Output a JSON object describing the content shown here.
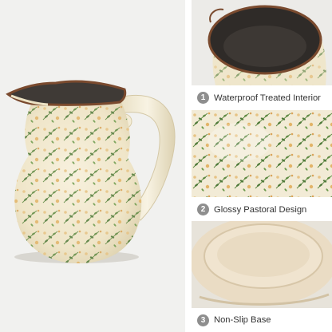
{
  "colors": {
    "background": "#f1f1ef",
    "glaze": "#f2ebd6",
    "rim": "#7a4a2e",
    "interior": "#3f3a36",
    "leaf": "#4f7a3a",
    "flower": "#e2b468",
    "badge": "#8e8e8e"
  },
  "main_image": {
    "icon": "floral-ceramic-pitcher"
  },
  "features": [
    {
      "number": "1",
      "label": "Waterproof Treated Interior",
      "icon": "pitcher-interior-closeup"
    },
    {
      "number": "2",
      "label": "Glossy Pastoral Design",
      "icon": "glaze-pattern-closeup"
    },
    {
      "number": "3",
      "label": "Non-Slip Base",
      "icon": "pitcher-base-closeup"
    }
  ]
}
